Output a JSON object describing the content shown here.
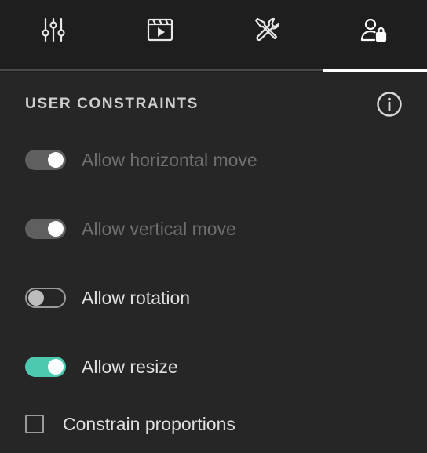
{
  "tabs": [
    {
      "name": "adjustments",
      "icon": "sliders-icon",
      "active": false
    },
    {
      "name": "media",
      "icon": "video-icon",
      "active": false
    },
    {
      "name": "tools",
      "icon": "tools-icon",
      "active": false
    },
    {
      "name": "user-constraints",
      "icon": "user-lock-icon",
      "active": true
    }
  ],
  "section": {
    "title": "USER CONSTRAINTS",
    "info_icon": "info-icon"
  },
  "constraints": [
    {
      "label": "Allow horizontal move",
      "on": true,
      "disabled": true
    },
    {
      "label": "Allow vertical move",
      "on": true,
      "disabled": true
    },
    {
      "label": "Allow rotation",
      "on": false,
      "disabled": false
    },
    {
      "label": "Allow resize",
      "on": true,
      "disabled": false
    }
  ],
  "constrain_proportions": {
    "label": "Constrain proportions",
    "checked": false
  },
  "colors": {
    "background": "#262626",
    "tabbar": "#1e1e1e",
    "accent": "#4dc9b0"
  }
}
